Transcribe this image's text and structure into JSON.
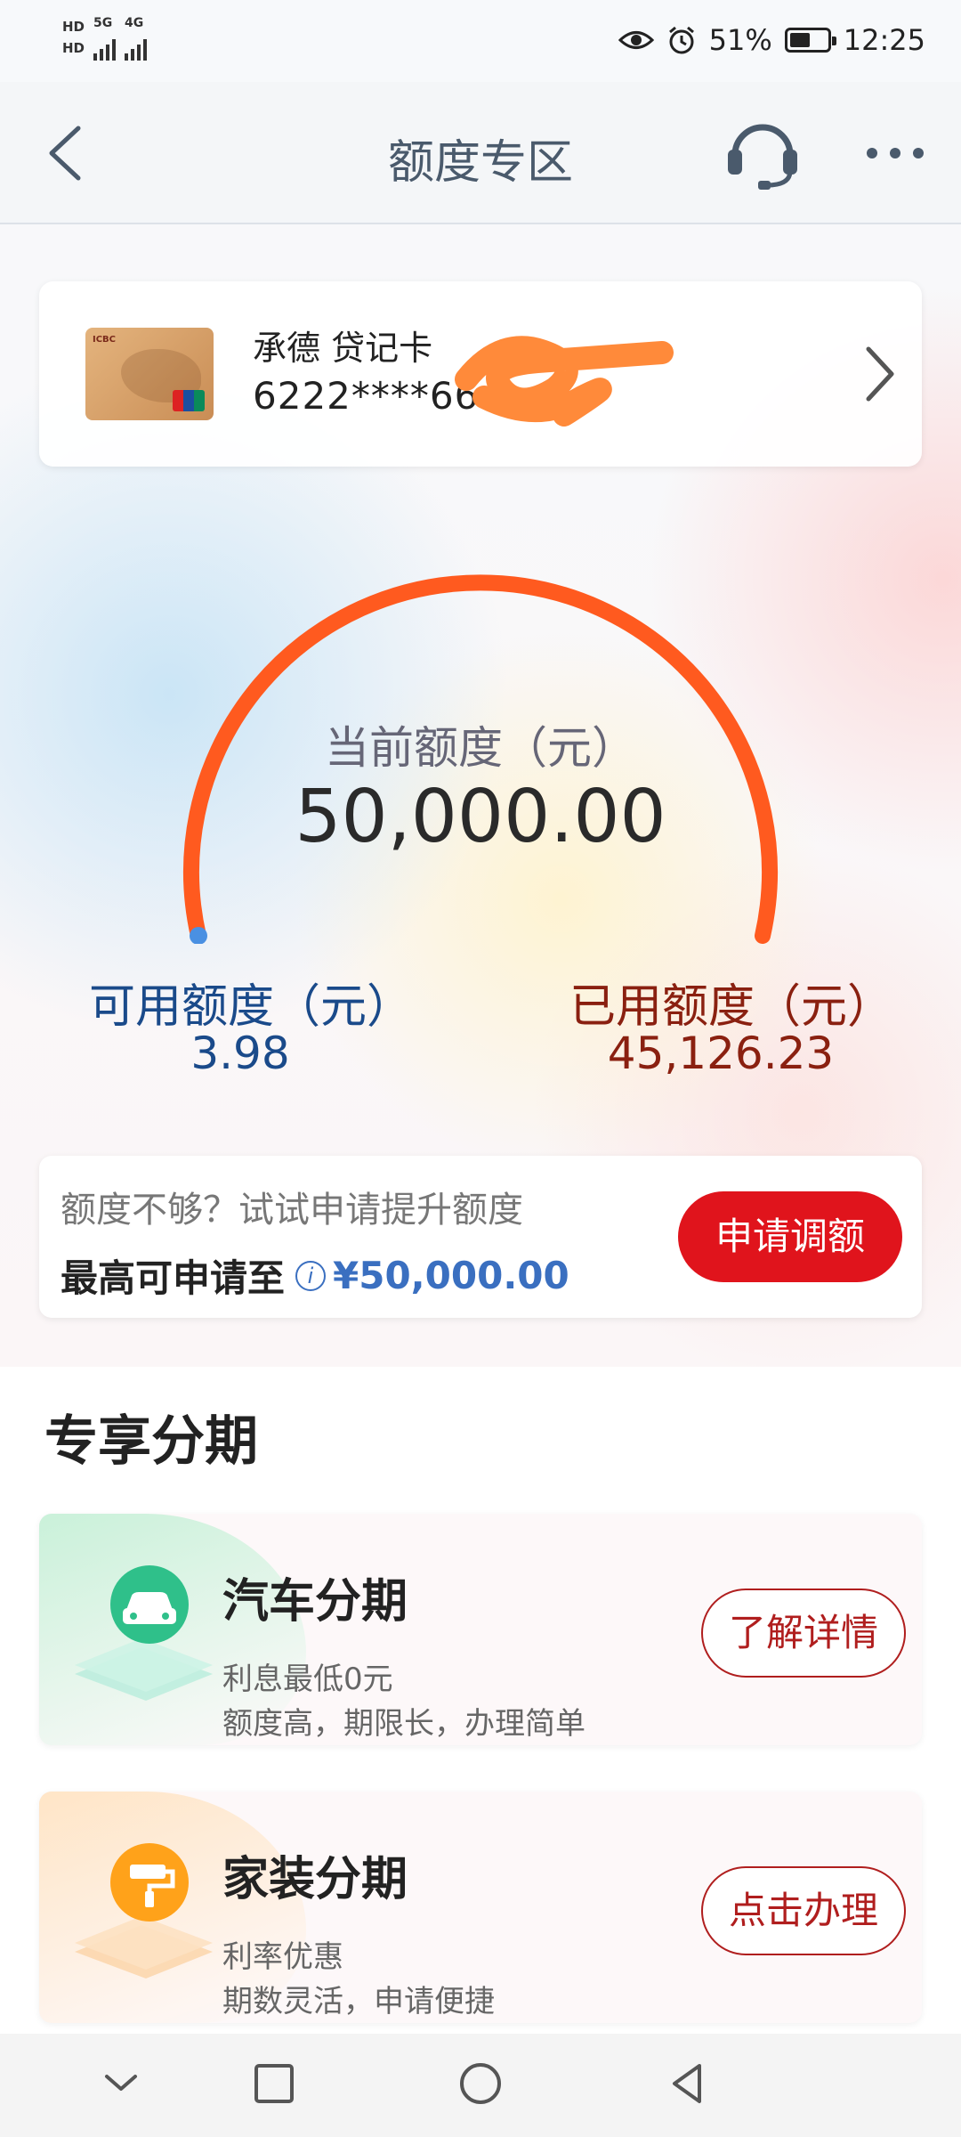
{
  "status_bar": {
    "hd1": "HD",
    "hd2": "HD",
    "net1": "5G",
    "net2": "4G",
    "battery": "51%",
    "time": "12:25"
  },
  "nav": {
    "title": "额度专区",
    "back_icon": "chevron-left-icon",
    "support_icon": "headset-icon",
    "more_icon": "more-dots-icon"
  },
  "card": {
    "name": "承德 贷记卡",
    "number": "6222****66"
  },
  "limit": {
    "current_label": "当前额度（元）",
    "current_value": "50,000.00",
    "available_label": "可用额度（元）",
    "available_value": "3.98",
    "used_label": "已用额度（元）",
    "used_value": "45,126.23"
  },
  "promo": {
    "line1": "额度不够？试试申请提升额度",
    "line2_prefix": "最高可申请至",
    "amount": "¥50,000.00",
    "button": "申请调额"
  },
  "section": {
    "title": "专享分期"
  },
  "plans": [
    {
      "title": "汽车分期",
      "sub1": "利息最低0元",
      "sub2": "额度高，期限长，办理简单",
      "button": "了解详情",
      "icon": "car-icon"
    },
    {
      "title": "家装分期",
      "sub1": "利率优惠",
      "sub2": "期数灵活，申请便捷",
      "button": "点击办理",
      "icon": "paint-roller-icon"
    }
  ],
  "colors": {
    "accent_red": "#e0141c",
    "gauge": "#ff5a1f",
    "available_blue": "#1a4a8a",
    "used_brown": "#8a2010"
  }
}
